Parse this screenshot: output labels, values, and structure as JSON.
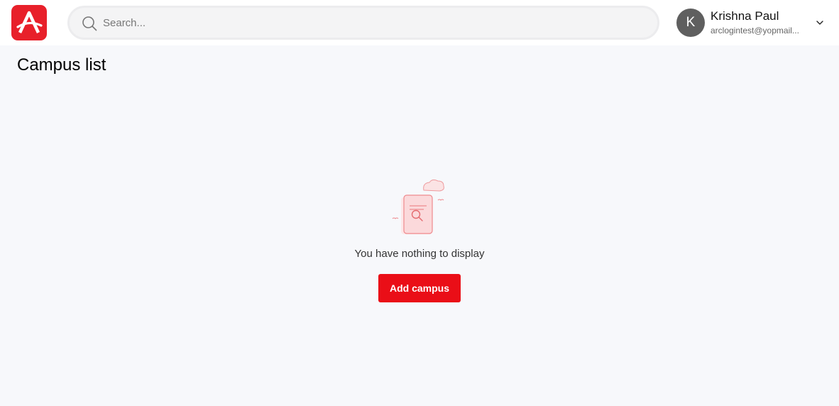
{
  "header": {
    "brand": "A",
    "search": {
      "placeholder": "Search...",
      "value": "",
      "icon": "search-icon"
    },
    "user": {
      "initial": "K",
      "name": "Krishna Paul",
      "email": "arclogintest@yopmail...",
      "menu_icon": "chevron-down-icon"
    }
  },
  "main": {
    "title": "Campus list",
    "empty_state": {
      "illustration": "empty-document-search-illustration",
      "message": "You have nothing to display",
      "action_label": "Add campus"
    }
  },
  "colors": {
    "accent": "#ea0e17",
    "logo": "#e8202a",
    "background": "#f7f8fb",
    "avatar": "#5f5f5f"
  }
}
